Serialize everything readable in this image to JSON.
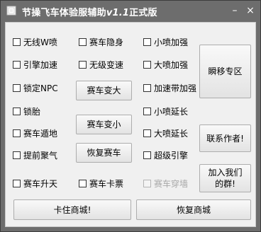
{
  "window": {
    "title_prefix": "节操飞车体验服辅助",
    "title_version": "v1.1",
    "title_suffix": "正式版",
    "controls": {
      "minimize": "–",
      "close": "×"
    }
  },
  "checkboxes": {
    "no_line_spray": "无线W喷",
    "engine_boost": "引擎加速",
    "lock_npc": "锁定NPC",
    "lock_tire": "锁胎",
    "kart_ground": "赛车遁地",
    "early_charge": "提前聚气",
    "kart_ascend": "赛车升天",
    "kart_stealth": "赛车隐身",
    "stepless_shift": "无级变速",
    "kart_stuck": "赛车卡票",
    "small_spray_boost": "小喷加强",
    "big_spray_boost": "大喷加强",
    "boost_band_strong": "加速带加强",
    "small_spray_extend": "小喷延长",
    "big_spray_extend": "大喷延长",
    "super_engine": "超级引擎",
    "wall_pass": "赛车穿墙"
  },
  "buttons": {
    "kart_bigger": "赛车变大",
    "kart_smaller": "赛车变小",
    "restore_kart": "恢复赛车",
    "teleport_zone": "瞬移专区",
    "contact_author": "联系作者!",
    "join_group": "加入我们的群!",
    "card_shop": "卡住商城!",
    "restore_shop": "恢复商城"
  }
}
